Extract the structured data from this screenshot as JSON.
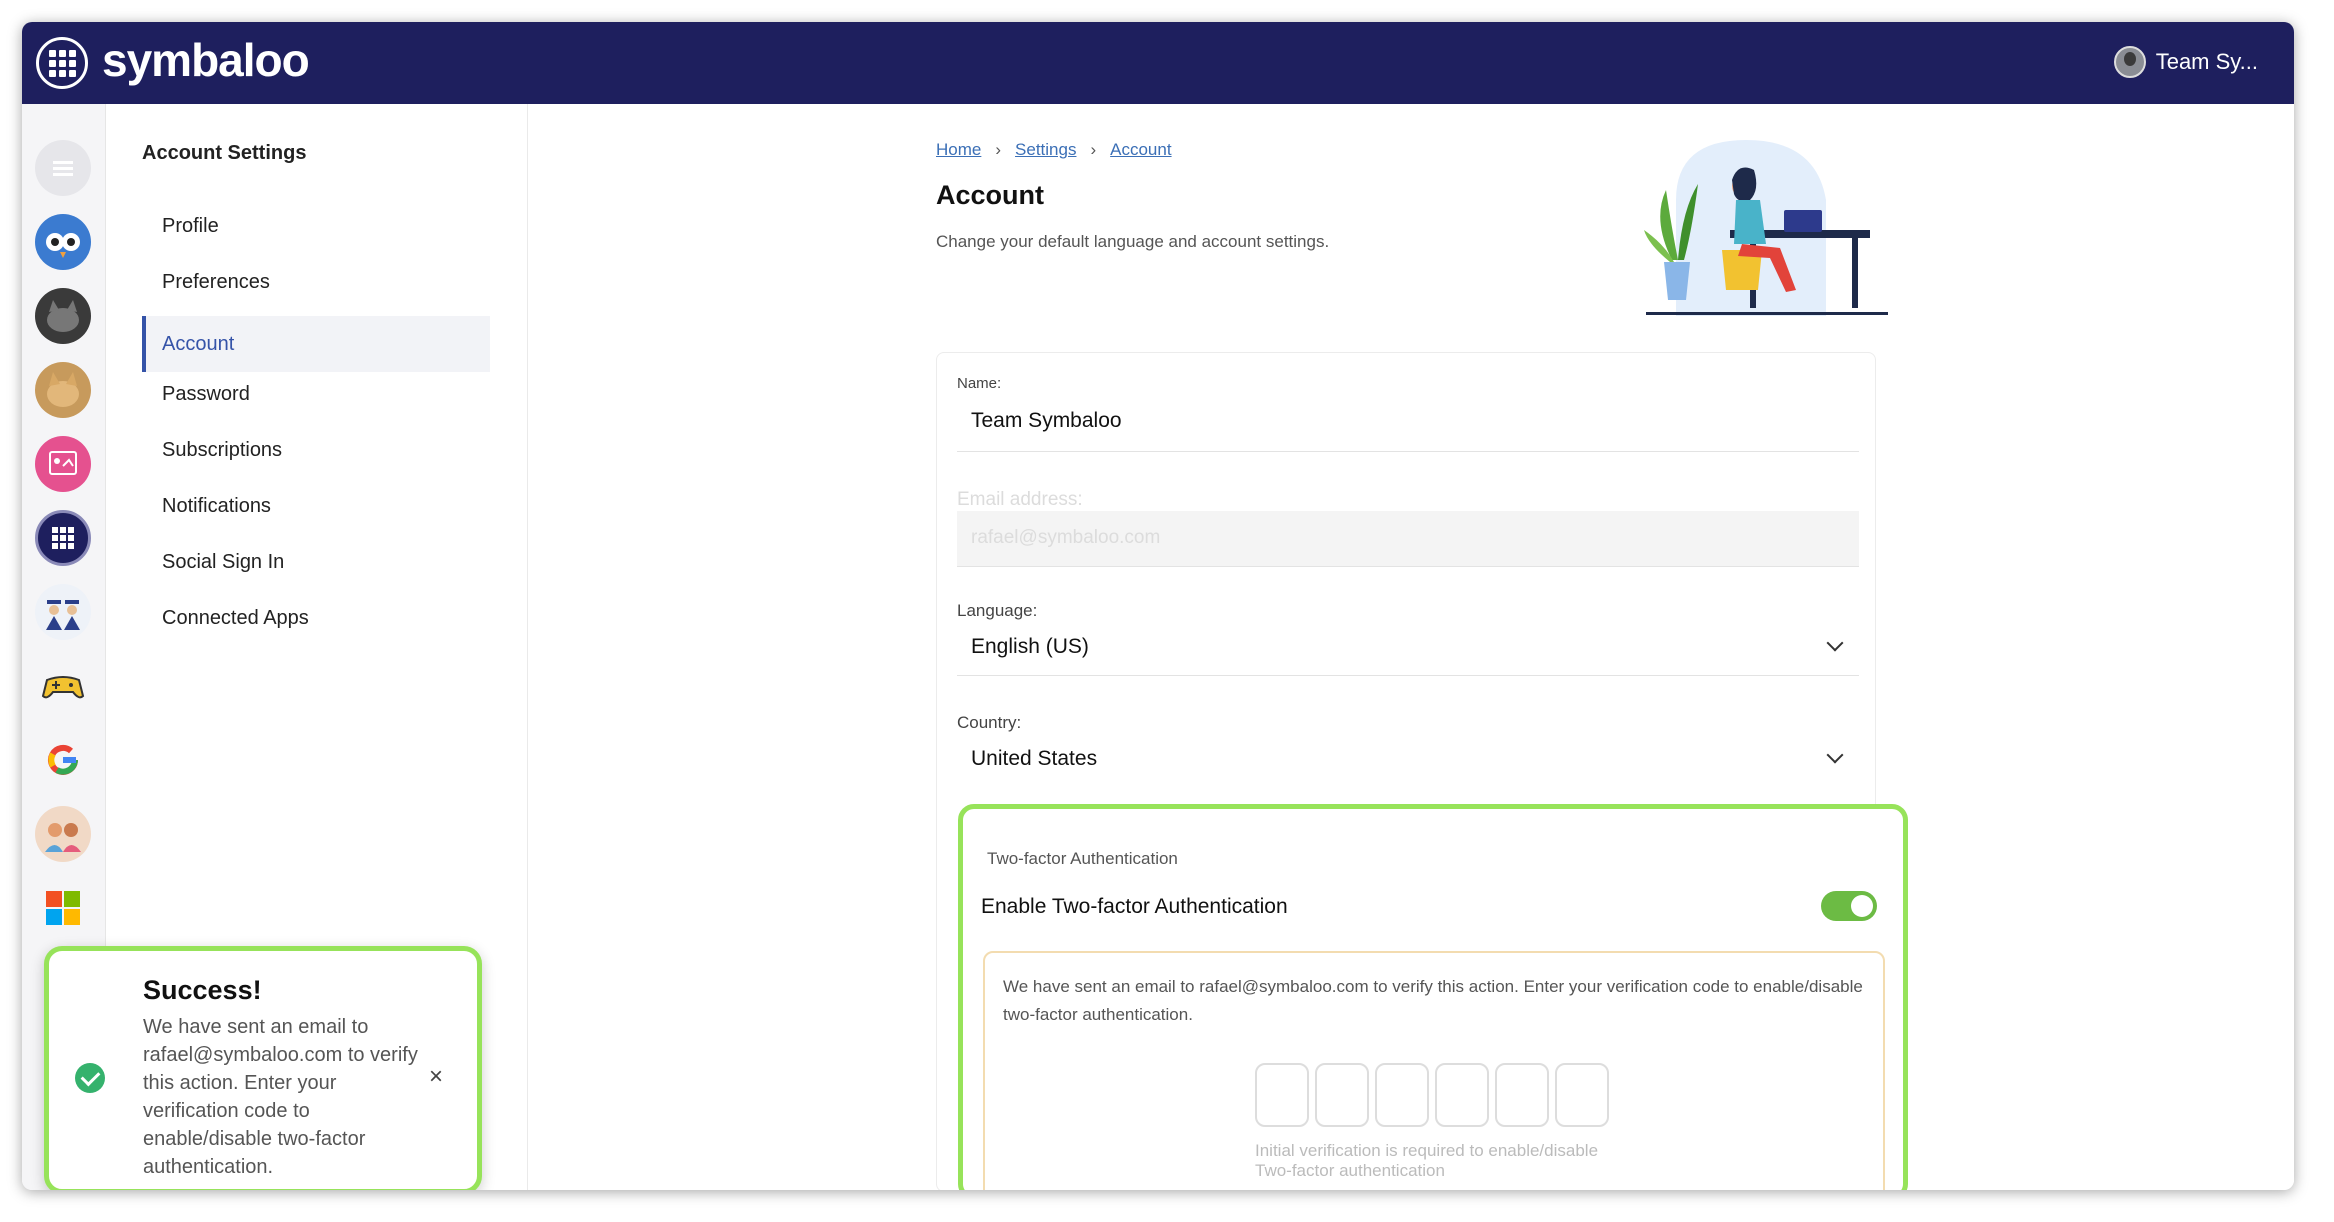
{
  "app": {
    "brand": "symbaloo"
  },
  "header": {
    "user_name": "Team Sy..."
  },
  "settings_nav": {
    "heading": "Account Settings",
    "items": [
      {
        "label": "Profile"
      },
      {
        "label": "Preferences"
      },
      {
        "label": "Account",
        "active": true
      },
      {
        "label": "Password"
      },
      {
        "label": "Subscriptions"
      },
      {
        "label": "Notifications"
      },
      {
        "label": "Social Sign In"
      },
      {
        "label": "Connected Apps"
      }
    ]
  },
  "breadcrumb": {
    "items": [
      "Home",
      "Settings",
      "Account"
    ],
    "separator": "›"
  },
  "page": {
    "title": "Account",
    "subtitle": "Change your default language and account settings."
  },
  "form": {
    "name_label": "Name:",
    "name_value": "Team Symbaloo",
    "email_label": "Email address:",
    "email_value": "rafael@symbaloo.com",
    "language_label": "Language:",
    "language_value": "English (US)",
    "country_label": "Country:",
    "country_value": "United States"
  },
  "two_factor": {
    "title": "Two-factor Authentication",
    "enable_label": "Enable Two-factor Authentication",
    "enabled": true,
    "message": "We have sent an email to rafael@symbaloo.com to verify this action. Enter your verification code to enable/disable two-factor authentication.",
    "code_length": 6,
    "hint": "Initial verification is required to enable/disable Two-factor authentication"
  },
  "toast": {
    "title": "Success!",
    "message": "We have sent an email to rafael@symbaloo.com to verify this action. Enter your verification code to enable/disable two-factor authentication.",
    "close_glyph": "×"
  },
  "colors": {
    "topbar": "#1e1f5e",
    "accent": "#3553a8",
    "highlight": "#97e35a",
    "toggle_on": "#6cbb44",
    "success": "#35b26d"
  },
  "icons": {
    "sidebar": [
      "list-icon",
      "owl-avatar",
      "cat-avatar",
      "cat2-avatar",
      "classroom-icon",
      "symbaloo-grid-icon",
      "graduates-icon",
      "gamepad-icon",
      "google-icon",
      "kids-avatar",
      "windows-tiles-icon"
    ]
  }
}
